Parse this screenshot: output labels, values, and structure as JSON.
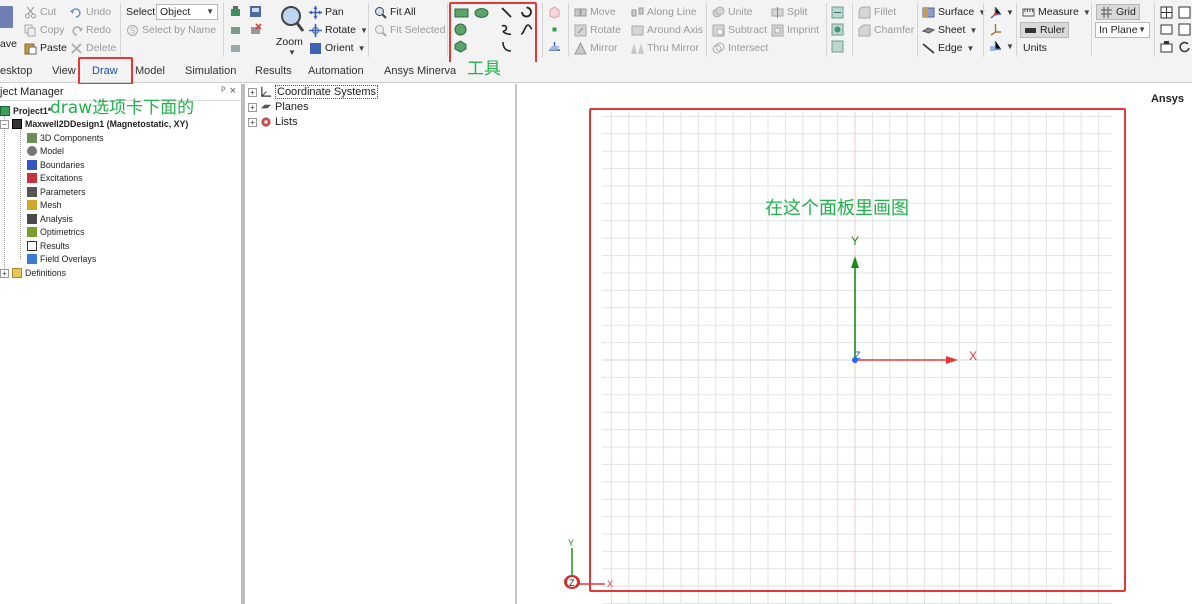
{
  "ribbon": {
    "clipboard": {
      "save": "ave",
      "cut": "Cut",
      "copy": "Copy",
      "paste": "Paste",
      "undo": "Undo",
      "redo": "Redo",
      "delete": "Delete"
    },
    "select": {
      "label": "Select:",
      "value": "Object",
      "select_by_name": "Select by Name"
    },
    "view": {
      "zoom": "Zoom",
      "pan": "Pan",
      "rotate": "Rotate",
      "orient": "Orient",
      "fit_all": "Fit All",
      "fit_selected": "Fit Selected"
    },
    "transform": {
      "move": "Move",
      "rotate": "Rotate",
      "mirror": "Mirror",
      "along_line": "Along Line",
      "around_axis": "Around Axis",
      "thru_mirror": "Thru Mirror"
    },
    "boolean": {
      "unite": "Unite",
      "subtract": "Subtract",
      "intersect": "Intersect",
      "split": "Split",
      "imprint": "Imprint"
    },
    "edit": {
      "fillet": "Fillet",
      "chamfer": "Chamfer",
      "surface": "Surface",
      "sheet": "Sheet",
      "edge": "Edge"
    },
    "measure": {
      "measure": "Measure",
      "ruler": "Ruler",
      "units": "Units"
    },
    "grid": {
      "grid": "Grid",
      "plane": "In Plane"
    }
  },
  "tabs": [
    "esktop",
    "View",
    "Draw",
    "Model",
    "Simulation",
    "Results",
    "Automation",
    "Ansys Minerva"
  ],
  "project_manager": {
    "title": "ject Manager",
    "project": "Project1*",
    "design": "Maxwell2DDesign1 (Magnetostatic, XY)",
    "items": [
      "3D Components",
      "Model",
      "Boundaries",
      "Excitations",
      "Parameters",
      "Mesh",
      "Analysis",
      "Optimetrics",
      "Results",
      "Field Overlays"
    ],
    "definitions": "Definitions"
  },
  "history_tree": {
    "items": [
      "Coordinate Systems",
      "Planes",
      "Lists"
    ]
  },
  "viewport": {
    "brand": "Ansys",
    "axis_x": "X",
    "axis_y": "Y",
    "axis_z": "Z",
    "triad_x": "X",
    "triad_y": "Y",
    "triad_z": "Z"
  },
  "annotations": {
    "tab_note": "draw选项卡下面的",
    "tools_note": "工具",
    "panel_note": "在这个面板里画图"
  },
  "colors": {
    "annotation_text": "#22b14c",
    "annotation_box": "#e53935",
    "axis_x": "#e53935",
    "axis_y": "#1a8a1a",
    "axis_z": "#2962ff",
    "grid_line": "#dfe3e6"
  }
}
